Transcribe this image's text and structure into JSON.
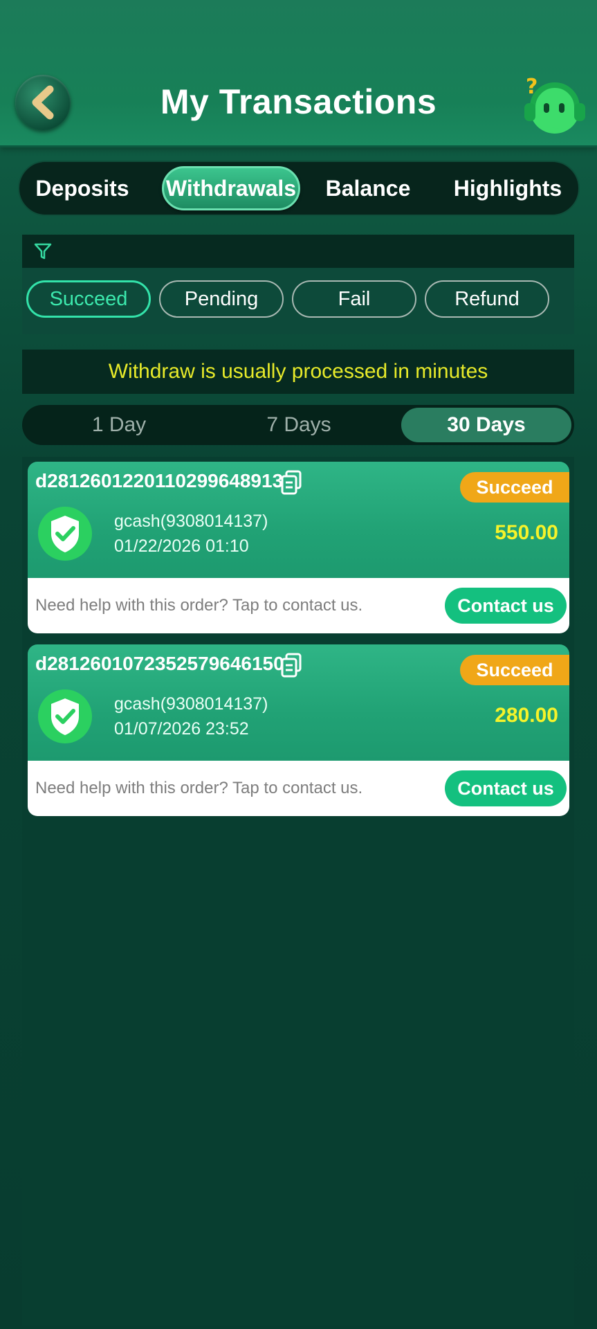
{
  "header": {
    "title": "My Transactions",
    "back_icon": "chevron-left-icon",
    "support_icon": "support-mascot-icon"
  },
  "tabs": [
    {
      "label": "Deposits",
      "active": false
    },
    {
      "label": "Withdrawals",
      "active": true
    },
    {
      "label": "Balance",
      "active": false
    },
    {
      "label": "Highlights",
      "active": false
    }
  ],
  "filter": {
    "icon": "filter-icon",
    "statuses": [
      {
        "label": "Succeed",
        "active": true
      },
      {
        "label": "Pending",
        "active": false
      },
      {
        "label": "Fail",
        "active": false
      },
      {
        "label": "Refund",
        "active": false
      }
    ]
  },
  "notice": "Withdraw is usually processed in minutes",
  "range": [
    {
      "label": "1 Day",
      "active": false
    },
    {
      "label": "7 Days",
      "active": false
    },
    {
      "label": "30 Days",
      "active": true
    }
  ],
  "transactions": [
    {
      "order_id": "d28126012201102996489​13",
      "status": "Succeed",
      "method": "gcash(9308014137)",
      "datetime": "01/22/2026 01:10",
      "amount": "550.00",
      "help_text": "Need help with this order? Tap to contact us.",
      "contact_label": "Contact us"
    },
    {
      "order_id": "d28126010723525796461​50",
      "status": "Succeed",
      "method": "gcash(9308014137)",
      "datetime": "01/07/2026 23:52",
      "amount": "280.00",
      "help_text": "Need help with this order? Tap to contact us.",
      "contact_label": "Contact us"
    }
  ],
  "colors": {
    "accent": "#33e3aa",
    "badge": "#f0a718",
    "amount": "#f6f32a",
    "notice": "#e7ea2a",
    "contact": "#14c07f"
  }
}
